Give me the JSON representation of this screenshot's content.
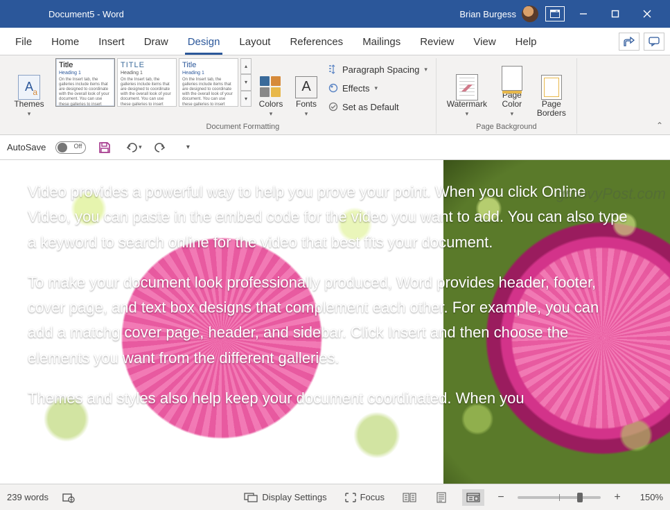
{
  "titlebar": {
    "title": "Document5  -  Word",
    "user": "Brian Burgess"
  },
  "watermark_credit": "groovyPost.com",
  "menu": {
    "tabs": [
      "File",
      "Home",
      "Insert",
      "Draw",
      "Design",
      "Layout",
      "References",
      "Mailings",
      "Review",
      "View",
      "Help"
    ],
    "active": "Design"
  },
  "ribbon": {
    "themes": "Themes",
    "style_cards": [
      {
        "title": "Title",
        "heading": "Heading 1",
        "title_color": "#000",
        "heading_color": "#2b579a"
      },
      {
        "title": "TITLE",
        "heading": "Heading 1",
        "title_color": "#3a6a9a",
        "heading_color": "#555"
      },
      {
        "title": "Title",
        "heading": "Heading 1",
        "title_color": "#2b579a",
        "heading_color": "#2b579a"
      }
    ],
    "colors": "Colors",
    "fonts": "Fonts",
    "paragraph_spacing": "Paragraph Spacing",
    "effects": "Effects",
    "set_default": "Set as Default",
    "group_docfmt": "Document Formatting",
    "watermark": "Watermark",
    "page_color": "Page\nColor",
    "page_borders": "Page\nBorders",
    "group_pagebg": "Page Background"
  },
  "qat": {
    "autosave_label": "AutoSave",
    "autosave_state": "Off"
  },
  "document": {
    "paragraphs": [
      "Video provides a powerful way to help you prove your point. When you click Online Video, you can paste in the embed code for the video you want to add. You can also type a keyword to search online for the video that best fits your document.",
      "To make your document look professionally produced, Word provides header, footer, cover page, and text box designs that complement each other. For example, you can add a matchg cover page, header, and sidebar. Click Insert and then choose the elements you want from the different galleries.",
      "Themes and styles also help keep your document coordinated. When you"
    ]
  },
  "statusbar": {
    "words": "239 words",
    "display_settings": "Display Settings",
    "focus": "Focus",
    "zoom": "150%",
    "zoom_thumb_pct": 72
  },
  "style_body_filler": "On the Insert tab, the galleries include items that are designed to coordinate with the overall look of your document. You can use these galleries to insert tables, headers, footers, lists, cover pages,"
}
